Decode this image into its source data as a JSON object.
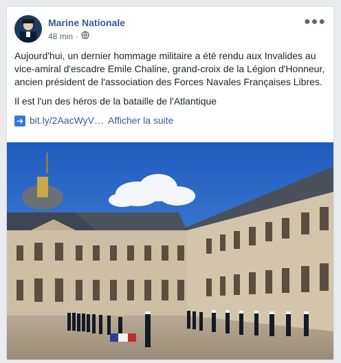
{
  "post": {
    "page_name": "Marine Nationale",
    "time": "48 min",
    "paragraph1": "Aujourd'hui, un dernier hommage militaire a été rendu aux Invalides au vice-amiral d'escadre Emile Chaline, grand-croix de la Légion d'Honneur, ancien président de l'association des Forces Navales Françaises Libres.",
    "paragraph2": "Il est l'un des héros de la bataille de l'Atlantique",
    "link_text": "bit.ly/2AacWyV…",
    "see_more": "Afficher la suite"
  },
  "icons": {
    "more": "more-options-icon",
    "privacy": "globe-icon",
    "link_arrow": "right-arrow-icon"
  },
  "colors": {
    "link": "#385898",
    "text": "#1d2129",
    "meta": "#606770",
    "sky": "#2f6ac6"
  }
}
